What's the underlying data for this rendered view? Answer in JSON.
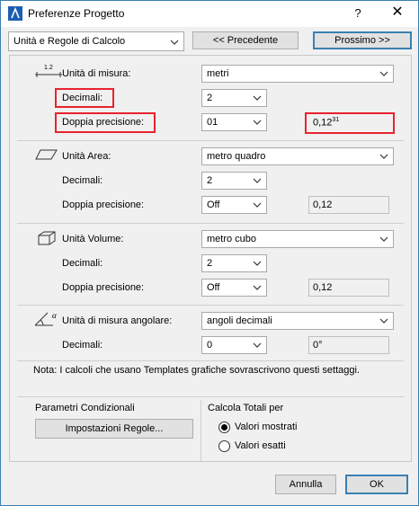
{
  "window": {
    "title": "Preferenze Progetto",
    "help_label": "?",
    "close_label": "✕"
  },
  "toolbar": {
    "category_value": "Unità e Regole di Calcolo",
    "prev_label": "<< Precedente",
    "next_label": "Prossimo >>"
  },
  "units": {
    "label": "Unità di misura:",
    "icon_text": "1.2",
    "value": "metri",
    "decimals_label": "Decimali:",
    "decimals_value": "2",
    "double_label": "Doppia precisione:",
    "double_value": "01",
    "preview_value": "0,12",
    "preview_sup": "31"
  },
  "area": {
    "label": "Unità Area:",
    "value": "metro quadro",
    "decimals_label": "Decimali:",
    "decimals_value": "2",
    "double_label": "Doppia precisione:",
    "double_value": "Off",
    "preview_value": "0,12"
  },
  "volume": {
    "label": "Unità Volume:",
    "value": "metro cubo",
    "decimals_label": "Decimali:",
    "decimals_value": "2",
    "double_label": "Doppia precisione:",
    "double_value": "Off",
    "preview_value": "0,12"
  },
  "angle": {
    "label": "Unità di misura angolare:",
    "icon_text": "α",
    "value": "angoli decimali",
    "decimals_label": "Decimali:",
    "decimals_value": "0",
    "preview_value": "0°"
  },
  "note": "Nota: I calcoli che usano Templates grafiche sovrascrivono questi settaggi.",
  "conditional": {
    "title": "Parametri Condizionali",
    "button_label": "Impostazioni Regole..."
  },
  "totals": {
    "title": "Calcola Totali per",
    "options": [
      "Valori mostrati",
      "Valori esatti"
    ],
    "selected_index": 0
  },
  "footer": {
    "cancel_label": "Annulla",
    "ok_label": "OK"
  },
  "colors": {
    "highlight": "#e8232e",
    "accent": "#3c7fb1"
  }
}
